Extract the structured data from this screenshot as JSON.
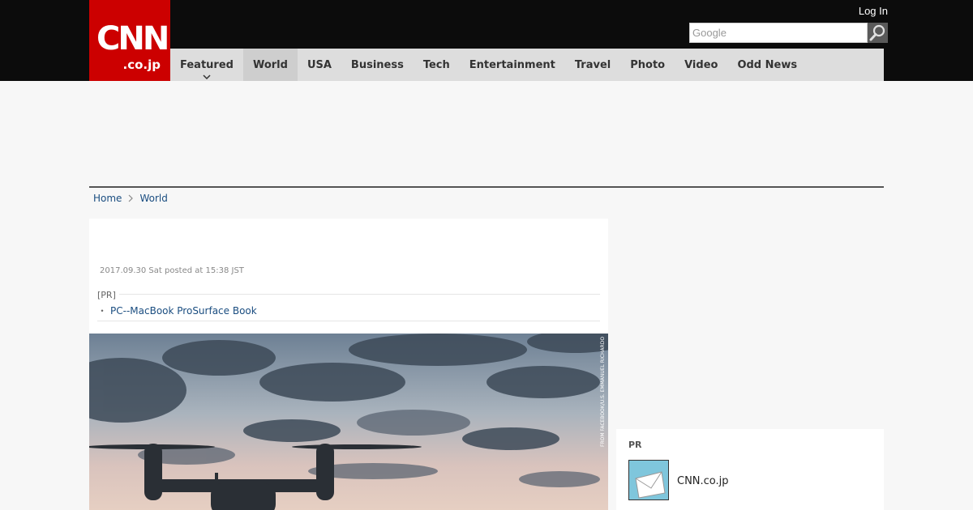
{
  "header": {
    "logo": {
      "mark": "CNN",
      "sub": ".co.jp"
    },
    "login_label": "Log In",
    "search": {
      "placeholder": "Google",
      "button_icon": "search-icon"
    }
  },
  "nav": {
    "items": [
      {
        "label": "Featured"
      },
      {
        "label": "World"
      },
      {
        "label": "USA"
      },
      {
        "label": "Business"
      },
      {
        "label": "Tech"
      },
      {
        "label": "Entertainment"
      },
      {
        "label": "Travel"
      },
      {
        "label": "Photo"
      },
      {
        "label": "Video"
      },
      {
        "label": "Odd News"
      }
    ],
    "active": "World"
  },
  "breadcrumb": {
    "items": [
      {
        "label": "Home"
      },
      {
        "label": "World"
      }
    ],
    "separator_icon": "chevron-right-icon"
  },
  "article": {
    "posted": "2017.09.30 Sat posted at 15:38 JST",
    "pr_tag": "[PR]",
    "pr_bullet": "・",
    "pr_link": "PC--MacBook ProSurface Book",
    "photo_credit": "FROM FACEBOOK/U.S. EMMANUEL RICHARDO",
    "photo_subject": "tiltrotor-aircraft-at-dusk"
  },
  "sidebar": {
    "pr": {
      "label": "PR",
      "thumbnail_icon": "envelope-icon",
      "name": "CNN.co.jp"
    }
  },
  "colors": {
    "brand_red": "#cc0000",
    "top_bar": "#0c0c0c",
    "nav_bg": "#dddddd",
    "link": "#1a4d80"
  }
}
